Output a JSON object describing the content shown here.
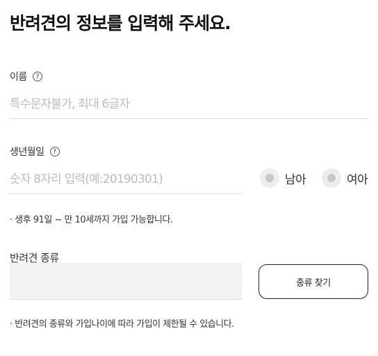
{
  "title": "반려견의 정보를 입력해 주세요.",
  "name_field": {
    "label": "이름",
    "placeholder": "특수문자불가, 최대 6글자"
  },
  "birth_field": {
    "label": "생년월일",
    "placeholder": "숫자 8자리 입력(예:20190301)"
  },
  "gender": {
    "male_label": "남아",
    "female_label": "여아"
  },
  "birth_note": "· 생후 91일 ~ 만 10세까지 가입 가능합니다.",
  "breed": {
    "label": "반려견 종류",
    "button_label": "종류 찾기"
  },
  "breed_note": "· 반려견의 종류와 가입나이에 따라 가입이 제한될 수 있습니다.",
  "help_glyph": "?"
}
